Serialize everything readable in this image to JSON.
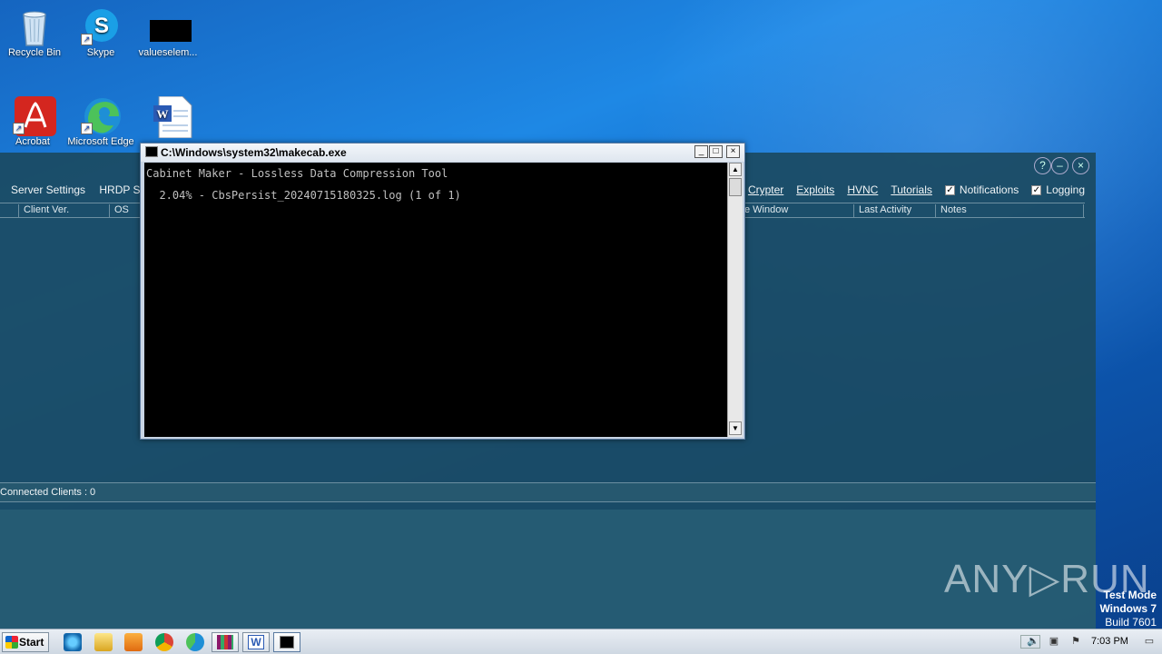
{
  "desktop": {
    "icons": [
      {
        "label": "Recycle Bin"
      },
      {
        "label": "Skype"
      },
      {
        "label": "valueselem..."
      },
      {
        "label": "Acrobat"
      },
      {
        "label": "Microsoft Edge"
      },
      {
        "label": ""
      }
    ]
  },
  "rat_app": {
    "menu_left": [
      "Server Settings",
      "HRDP S"
    ],
    "menu_right_links": [
      "Crypter",
      "Exploits",
      "HVNC",
      "Tutorials"
    ],
    "checkboxes": [
      {
        "label": "Notifications",
        "checked": true
      },
      {
        "label": "Logging",
        "checked": true
      }
    ],
    "columns": [
      "Client Ver.",
      "OS",
      "e Window",
      "Last Activity",
      "Notes"
    ],
    "status": "Connected Clients : 0",
    "controls": {
      "help": "?",
      "minimize": "–",
      "close": "×"
    }
  },
  "console": {
    "title": "C:\\Windows\\system32\\makecab.exe",
    "lines": [
      "Cabinet Maker - Lossless Data Compression Tool",
      "  2.04% - CbsPersist_20240715180325.log (1 of 1)"
    ],
    "buttons": {
      "minimize": "_",
      "maximize": "□",
      "close": "×"
    }
  },
  "watermark": {
    "brand": "ANY▷RUN"
  },
  "test_mode": {
    "line1": "Test Mode",
    "line2": "Windows 7",
    "line3": "Build 7601"
  },
  "taskbar": {
    "start_label": "Start",
    "clock": "7:03 PM",
    "pinned": [
      "ie-icon",
      "explorer-icon",
      "media-player-icon",
      "chrome-icon",
      "edge-icon",
      "winrar-icon",
      "word-icon",
      "console-icon"
    ]
  }
}
